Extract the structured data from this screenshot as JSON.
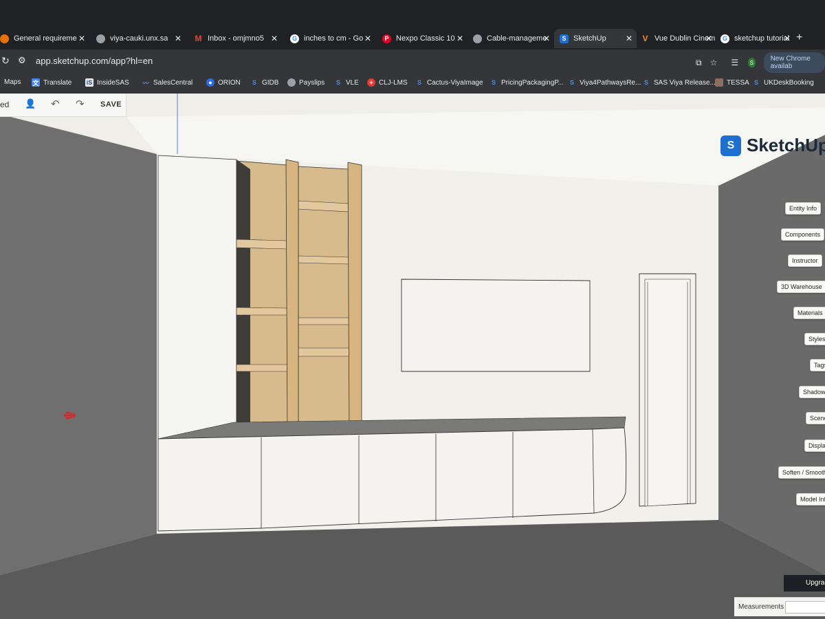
{
  "browser": {
    "tabs": [
      {
        "title": "General requireme",
        "icon": "google-docs-icon",
        "color": "#e8710a"
      },
      {
        "title": "viya-cauki.unx.sa",
        "icon": "globe-icon",
        "color": "#9aa0a6"
      },
      {
        "title": "Inbox - omjmno5",
        "icon": "gmail-icon",
        "color": "#ea4335"
      },
      {
        "title": "inches to cm - Go",
        "icon": "google-icon",
        "color": "#4285f4"
      },
      {
        "title": "Nexpo Classic 10",
        "icon": "pinterest-icon",
        "color": "#e60023"
      },
      {
        "title": "Cable-manageme",
        "icon": "globe-icon",
        "color": "#9aa0a6"
      },
      {
        "title": "SketchUp",
        "icon": "sketchup-icon",
        "color": "#1e6fcf",
        "active": true
      },
      {
        "title": "Vue Dublin Cinem",
        "icon": "vue-icon",
        "color": "#f28c28"
      },
      {
        "title": "sketchup tutorial",
        "icon": "google-icon",
        "color": "#4285f4"
      }
    ],
    "url": "app.sketchup.com/app?hl=en",
    "bookmarks": [
      {
        "label": "Maps",
        "icon": "maps-icon"
      },
      {
        "label": "Translate",
        "icon": "translate-icon"
      },
      {
        "label": "InsideSAS",
        "icon": "insidesas-icon"
      },
      {
        "label": "SalesCentral",
        "icon": "salescentral-icon"
      },
      {
        "label": "ORION",
        "icon": "orion-icon"
      },
      {
        "label": "GIDB",
        "icon": "sas-icon"
      },
      {
        "label": "Payslips",
        "icon": "globe-icon"
      },
      {
        "label": "VLE",
        "icon": "sas-icon"
      },
      {
        "label": "CLJ-LMS",
        "icon": "clj-icon"
      },
      {
        "label": "Cactus-ViyaImage",
        "icon": "sas-icon"
      },
      {
        "label": "PricingPackagingP...",
        "icon": "sas-icon"
      },
      {
        "label": "Viya4PathwaysRe...",
        "icon": "sas-icon"
      },
      {
        "label": "SAS Viya Release...",
        "icon": "sas-icon"
      },
      {
        "label": "TESSA",
        "icon": "tessa-icon"
      },
      {
        "label": "UKDeskBooking",
        "icon": "sas-icon"
      }
    ],
    "profile_initial": "S",
    "chrome_notice": "New Chrome availab"
  },
  "sketchup": {
    "topbar": {
      "left_text": "ed",
      "save_label": "SAVE"
    },
    "logo_text": "SketchUp",
    "panels": [
      "Entity Info",
      "Components",
      "Instructor",
      "3D Warehouse",
      "Materials",
      "Styles",
      "Tags",
      "Shadows",
      "Scenes",
      "Display",
      "Soften / Smooth",
      "Model Info"
    ],
    "upgrade_label": "Upgrad",
    "measurements_label": "Measurements"
  },
  "colors": {
    "wall": "#efeee9",
    "side_wall": "#6d6d6d",
    "floor": "#575757",
    "wood": "#d7b98a",
    "accent": "#1e6fcf"
  }
}
